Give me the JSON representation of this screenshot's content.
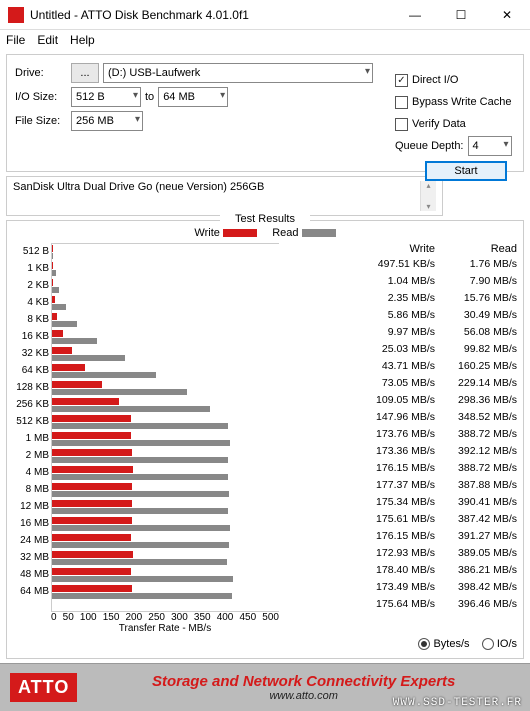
{
  "window": {
    "title": "Untitled - ATTO Disk Benchmark 4.01.0f1"
  },
  "menu": {
    "file": "File",
    "edit": "Edit",
    "help": "Help"
  },
  "config": {
    "drive_label": "Drive:",
    "drive_browse": "...",
    "drive_value": "(D:) USB-Laufwerk",
    "io_label": "I/O Size:",
    "io_from": "512 B",
    "io_to_label": "to",
    "io_to": "64 MB",
    "fsize_label": "File Size:",
    "fsize_value": "256 MB"
  },
  "options": {
    "direct_io": "Direct I/O",
    "direct_io_checked": "✓",
    "bypass": "Bypass Write Cache",
    "verify": "Verify Data",
    "queue_label": "Queue Depth:",
    "queue_value": "4",
    "start": "Start"
  },
  "device": "SanDisk Ultra Dual Drive Go (neue Version) 256GB",
  "chart_data": {
    "type": "bar",
    "title": "Test Results",
    "xlabel": "Transfer Rate - MB/s",
    "xlim": [
      0,
      500
    ],
    "xticks": [
      "0",
      "50",
      "100",
      "150",
      "200",
      "250",
      "300",
      "350",
      "400",
      "450",
      "500"
    ],
    "legend": {
      "write": "Write",
      "read": "Read"
    },
    "categories": [
      "512 B",
      "1 KB",
      "2 KB",
      "4 KB",
      "8 KB",
      "16 KB",
      "32 KB",
      "64 KB",
      "128 KB",
      "256 KB",
      "512 KB",
      "1 MB",
      "2 MB",
      "4 MB",
      "8 MB",
      "12 MB",
      "16 MB",
      "24 MB",
      "32 MB",
      "48 MB",
      "64 MB"
    ],
    "series": [
      {
        "name": "Write",
        "unit_labels": [
          "497.51 KB/s",
          "1.04 MB/s",
          "2.35 MB/s",
          "5.86 MB/s",
          "9.97 MB/s",
          "25.03 MB/s",
          "43.71 MB/s",
          "73.05 MB/s",
          "109.05 MB/s",
          "147.96 MB/s",
          "173.76 MB/s",
          "173.36 MB/s",
          "176.15 MB/s",
          "177.37 MB/s",
          "175.34 MB/s",
          "175.61 MB/s",
          "176.15 MB/s",
          "172.93 MB/s",
          "178.40 MB/s",
          "173.49 MB/s",
          "175.64 MB/s"
        ],
        "values_mb": [
          0.49,
          1.04,
          2.35,
          5.86,
          9.97,
          25.03,
          43.71,
          73.05,
          109.05,
          147.96,
          173.76,
          173.36,
          176.15,
          177.37,
          175.34,
          175.61,
          176.15,
          172.93,
          178.4,
          173.49,
          175.64
        ]
      },
      {
        "name": "Read",
        "unit_labels": [
          "1.76 MB/s",
          "7.90 MB/s",
          "15.76 MB/s",
          "30.49 MB/s",
          "56.08 MB/s",
          "99.82 MB/s",
          "160.25 MB/s",
          "229.14 MB/s",
          "298.36 MB/s",
          "348.52 MB/s",
          "388.72 MB/s",
          "392.12 MB/s",
          "388.72 MB/s",
          "387.88 MB/s",
          "390.41 MB/s",
          "387.42 MB/s",
          "391.27 MB/s",
          "389.05 MB/s",
          "386.21 MB/s",
          "398.42 MB/s",
          "396.46 MB/s"
        ],
        "values_mb": [
          1.76,
          7.9,
          15.76,
          30.49,
          56.08,
          99.82,
          160.25,
          229.14,
          298.36,
          348.52,
          388.72,
          392.12,
          388.72,
          387.88,
          390.41,
          387.42,
          391.27,
          389.05,
          386.21,
          398.42,
          396.46
        ]
      }
    ],
    "header_write": "Write",
    "header_read": "Read"
  },
  "radio": {
    "bytes": "Bytes/s",
    "ios": "IO/s"
  },
  "footer": {
    "logo": "ATTO",
    "title": "Storage and Network Connectivity Experts",
    "url": "www.atto.com",
    "watermark": "WWW.SSD-TESTER.FR"
  }
}
